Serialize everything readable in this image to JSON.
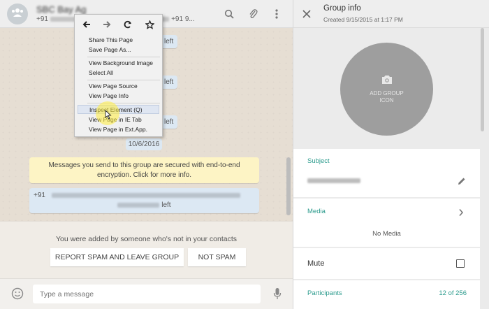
{
  "chat": {
    "title": "SBC Bay Ag",
    "subtitle_prefix": "+91",
    "subtitle_end": "+91 9...",
    "bubble_suffix": "left",
    "date_chip": "10/6/2016",
    "encryption_notice": "Messages you send to this group are secured with end-to-end encryption. Click for more info.",
    "participants_msg_prefix": "+91",
    "spam_notice": "You were added by someone who's not in your contacts",
    "report_button": "REPORT SPAM AND LEAVE GROUP",
    "not_spam_button": "NOT SPAM",
    "composer_placeholder": "Type a message"
  },
  "context_menu": {
    "items": [
      "Share This Page",
      "Save Page As...",
      "View Background Image",
      "Select All",
      "View Page Source",
      "View Page Info",
      "Inspect Element (Q)",
      "View Page in IE Tab",
      "View Page in Ext.App."
    ]
  },
  "group_info": {
    "title": "Group info",
    "created": "Created 9/15/2015 at 1:17 PM",
    "add_icon_label": "ADD GROUP ICON",
    "subject_label": "Subject",
    "media_label": "Media",
    "no_media": "No Media",
    "mute_label": "Mute",
    "participants_label": "Participants",
    "participants_count": "12 of 256"
  },
  "colors": {
    "accent": "#2c9b8d",
    "notice_bg": "#fdf4c5",
    "bubble_bg": "#dce8f3"
  }
}
